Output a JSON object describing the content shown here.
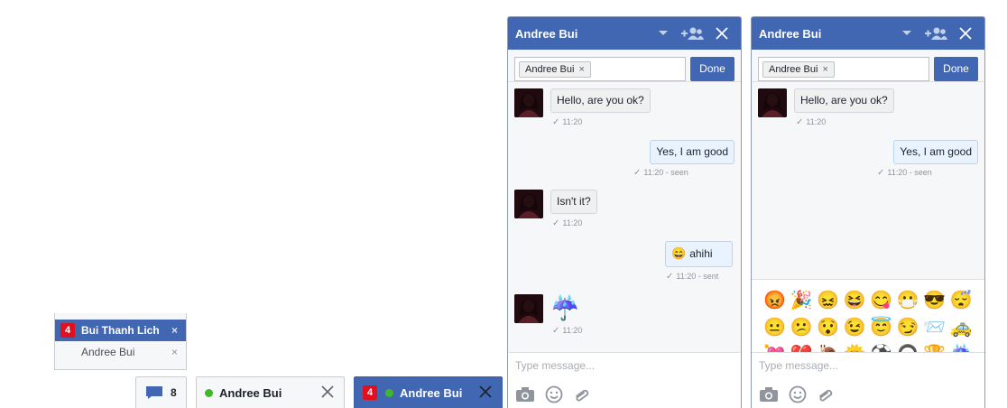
{
  "overflow": {
    "items": [
      {
        "name": "Bui Thanh Lich",
        "badge": "4",
        "close": "×",
        "active": true
      },
      {
        "name": "Andree Bui",
        "close": "×",
        "active": false
      }
    ],
    "count": "8",
    "icon": "chat-bubble-icon"
  },
  "tabs": [
    {
      "name": "Andree Bui",
      "status_color": "#42b72a"
    },
    {
      "name": "Andree Bui",
      "badge": "4",
      "status_color": "#42b72a"
    }
  ],
  "windows": [
    {
      "title": "Andree Bui",
      "to_chip": "Andree Bui",
      "chip_close": "×",
      "done_label": "Done",
      "messages": [
        {
          "dir": "in",
          "text": "Hello, are you ok?",
          "meta": "11:20"
        },
        {
          "dir": "out",
          "text": "Yes, I am good",
          "meta": "11:20 - seen"
        },
        {
          "dir": "in",
          "text": "Isn't it?",
          "meta": "11:20"
        },
        {
          "dir": "out",
          "text": "ahihi",
          "emoji": "😄",
          "meta": "11:20 - sent"
        },
        {
          "dir": "in",
          "sticker": "☔",
          "meta": "11:20"
        }
      ],
      "placeholder": "Type message..."
    },
    {
      "title": "Andree Bui",
      "to_chip": "Andree Bui",
      "chip_close": "×",
      "done_label": "Done",
      "messages": [
        {
          "dir": "in",
          "text": "Hello, are you ok?",
          "meta": "11:20"
        },
        {
          "dir": "out",
          "text": "Yes, I am good",
          "meta": "11:20 - seen"
        }
      ],
      "emojis": [
        "😡",
        "🎉",
        "😖",
        "😆",
        "😋",
        "😷",
        "😎",
        "😴",
        "😐",
        "😕",
        "😯",
        "😉",
        "😇",
        "😏",
        "📨",
        "🚕",
        "💘",
        "💔",
        "🐌",
        "🌞",
        "⚽",
        "🎧",
        "🏆",
        "☔"
      ],
      "placeholder": "Type message..."
    }
  ],
  "colors": {
    "accent": "#4267b2",
    "online": "#42b72a",
    "badge": "#e0101e"
  }
}
